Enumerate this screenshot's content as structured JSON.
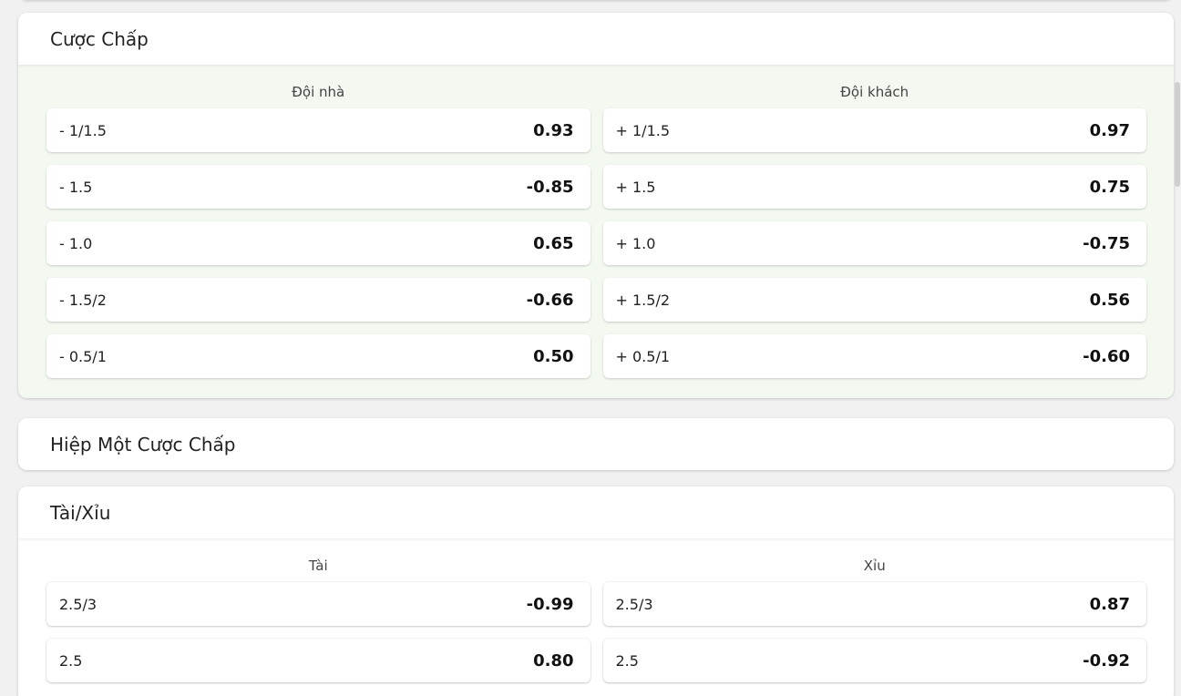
{
  "handicap": {
    "title": "Cược Chấp",
    "home_label": "Đội nhà",
    "away_label": "Đội khách",
    "home_rows": [
      {
        "line": "- 1/1.5",
        "price": "0.93"
      },
      {
        "line": "- 1.5",
        "price": "-0.85"
      },
      {
        "line": "- 1.0",
        "price": "0.65"
      },
      {
        "line": "- 1.5/2",
        "price": "-0.66"
      },
      {
        "line": "- 0.5/1",
        "price": "0.50"
      }
    ],
    "away_rows": [
      {
        "line": "+ 1/1.5",
        "price": "0.97"
      },
      {
        "line": "+ 1.5",
        "price": "0.75"
      },
      {
        "line": "+ 1.0",
        "price": "-0.75"
      },
      {
        "line": "+ 1.5/2",
        "price": "0.56"
      },
      {
        "line": "+ 0.5/1",
        "price": "-0.60"
      }
    ]
  },
  "first_half_handicap": {
    "title": "Hiệp Một Cược Chấp"
  },
  "over_under": {
    "title": "Tài/Xỉu",
    "over_label": "Tài",
    "under_label": "Xỉu",
    "over_rows": [
      {
        "line": "2.5/3",
        "price": "-0.99"
      },
      {
        "line": "2.5",
        "price": "0.80"
      }
    ],
    "under_rows": [
      {
        "line": "2.5/3",
        "price": "0.87"
      },
      {
        "line": "2.5",
        "price": "-0.92"
      }
    ]
  }
}
